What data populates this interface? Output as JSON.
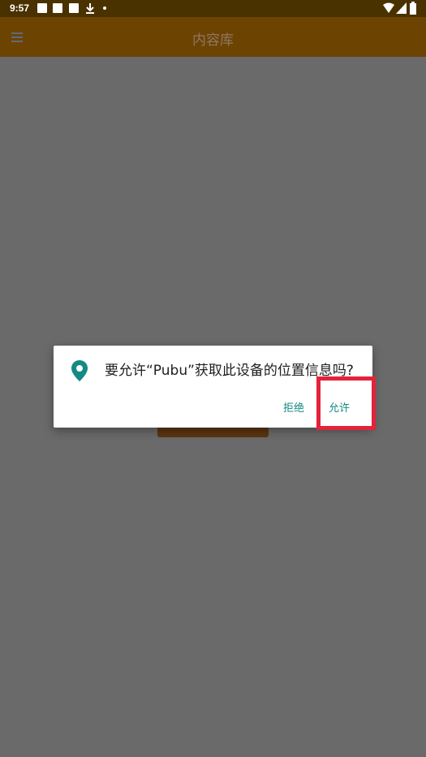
{
  "status_bar": {
    "time": "9:57"
  },
  "app_bar": {
    "title": "内容库",
    "menu_icon": "menu-icon"
  },
  "dialog": {
    "message": "要允许“Pubu”获取此设备的位置信息吗?",
    "deny_label": "拒绝",
    "allow_label": "允许",
    "icon": "location-pin-icon"
  },
  "colors": {
    "status_bar": "#4a3100",
    "app_bar": "#6d4302",
    "overlay": "#6a6a6a",
    "accent": "#138a83",
    "highlight": "#e2233a"
  }
}
